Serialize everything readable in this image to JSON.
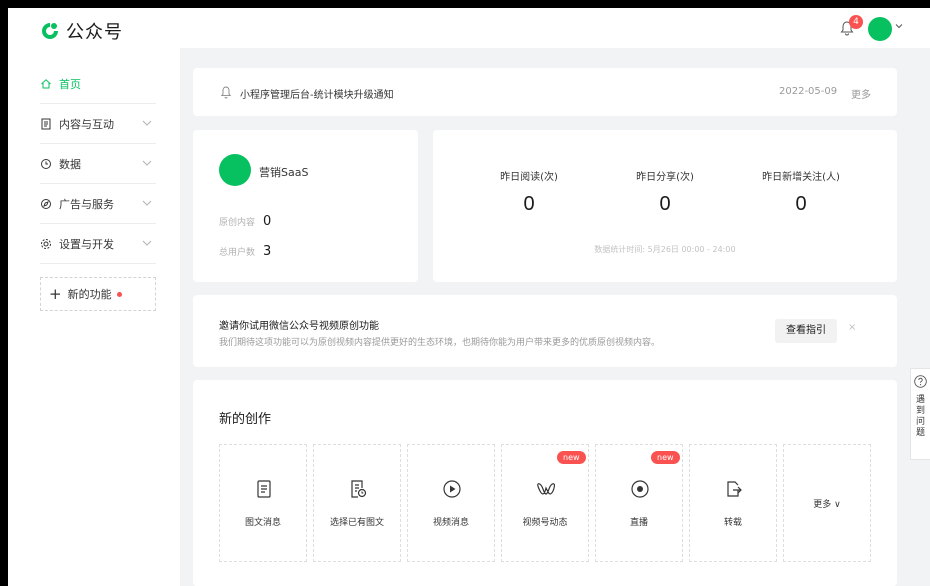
{
  "header": {
    "brand": "公众号",
    "notification_count": "4",
    "colors": {
      "accent": "#07c160",
      "badge": "#fa5151"
    }
  },
  "sidebar": {
    "items": [
      {
        "label": "首页",
        "icon": "home-icon",
        "active": true
      },
      {
        "label": "内容与互动",
        "icon": "document-icon"
      },
      {
        "label": "数据",
        "icon": "clock-icon"
      },
      {
        "label": "广告与服务",
        "icon": "compass-icon"
      },
      {
        "label": "设置与开发",
        "icon": "gear-icon"
      }
    ],
    "new_feature": "新的功能"
  },
  "notice": {
    "text": "小程序管理后台-统计模块升级通知",
    "date": "2022-05-09",
    "more": "更多"
  },
  "account": {
    "name": "营销SaaS",
    "original_label": "原创内容",
    "original_value": "0",
    "users_label": "总用户数",
    "users_value": "3"
  },
  "stats": {
    "items": [
      {
        "label": "昨日阅读(次)",
        "value": "0"
      },
      {
        "label": "昨日分享(次)",
        "value": "0"
      },
      {
        "label": "昨日新增关注(人)",
        "value": "0"
      }
    ],
    "footnote": "数据统计时间: 5月26日 00:00 - 24:00"
  },
  "invite": {
    "title": "邀请你试用微信公众号视频原创功能",
    "description": "我们期待这项功能可以为原创视频内容提供更好的生态环境，也期待你能为用户带来更多的优质原创视频内容。",
    "button": "查看指引",
    "close": "×"
  },
  "create": {
    "title": "新的创作",
    "tiles": [
      {
        "label": "图文消息",
        "icon": "article-icon"
      },
      {
        "label": "选择已有图文",
        "icon": "article-history-icon"
      },
      {
        "label": "视频消息",
        "icon": "play-icon"
      },
      {
        "label": "视频号动态",
        "icon": "channels-icon",
        "tag": "new"
      },
      {
        "label": "直播",
        "icon": "live-icon",
        "tag": "new"
      },
      {
        "label": "转载",
        "icon": "repost-icon"
      },
      {
        "label": "更多 ∨",
        "icon": ""
      }
    ]
  },
  "help": {
    "text": "遇到问题"
  }
}
